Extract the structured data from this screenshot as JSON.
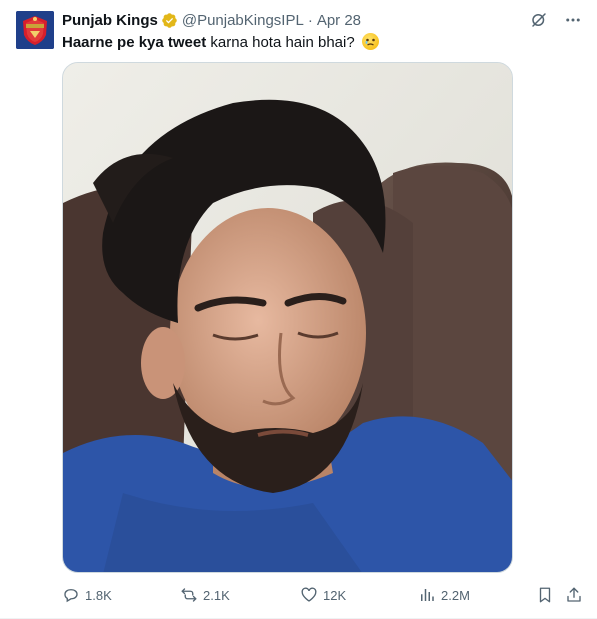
{
  "author": {
    "name": "Punjab Kings",
    "handle": "@PunjabKingsIPL",
    "separator": "·",
    "date": "Apr 28",
    "avatar_text": "PUNJAB"
  },
  "tweet": {
    "text_bold": "Haarne pe kya tweet",
    "text_rest": " karna hota hain bhai?",
    "emoji": "face-holding-back-tears"
  },
  "stats": {
    "replies": "1.8K",
    "retweets": "2.1K",
    "likes": "12K",
    "views": "2.2M"
  },
  "icons": {
    "verified": "verified-badge-icon",
    "grok": "grok-icon",
    "more": "more-icon",
    "reply": "reply-icon",
    "retweet": "retweet-icon",
    "like": "heart-icon",
    "views": "views-icon",
    "bookmark": "bookmark-icon",
    "share": "share-icon"
  },
  "colors": {
    "text_primary": "#0f1419",
    "text_secondary": "#536471",
    "verified_gold": "#e2b719",
    "border": "#cfd9de",
    "avatar_bg": "#1f3f8a"
  }
}
